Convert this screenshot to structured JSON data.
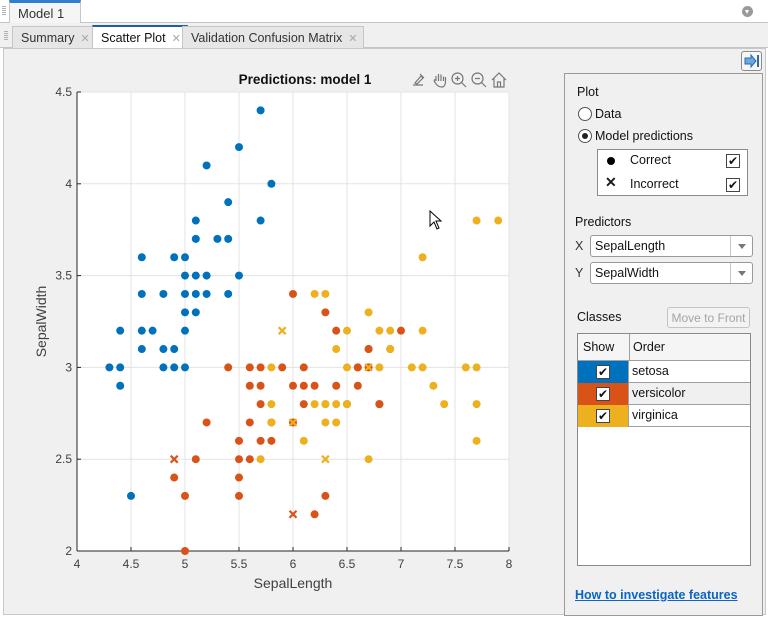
{
  "document_tabs": [
    {
      "label": "Model 1",
      "active": true
    }
  ],
  "tabs": [
    {
      "label": "Summary",
      "active": false
    },
    {
      "label": "Scatter Plot",
      "active": true
    },
    {
      "label": "Validation Confusion Matrix",
      "active": false
    }
  ],
  "axes_toolbar": [
    "brush-icon",
    "pan-icon",
    "zoom-in-icon",
    "zoom-out-icon",
    "home-icon"
  ],
  "panel": {
    "plot_heading": "Plot",
    "radio_data": "Data",
    "radio_predictions": "Model predictions",
    "selected_radio": "Model predictions",
    "legend_correct": "Correct",
    "legend_incorrect": "Incorrect",
    "show_correct": true,
    "show_incorrect": true,
    "predictors_heading": "Predictors",
    "x_label": "X",
    "y_label": "Y",
    "x_value": "SepalLength",
    "y_value": "SepalWidth",
    "classes_heading": "Classes",
    "move_to_front": "Move to Front",
    "col_show": "Show",
    "col_order": "Order",
    "classes": [
      {
        "name": "setosa",
        "color": "#0072BD",
        "shown": true
      },
      {
        "name": "versicolor",
        "color": "#D95319",
        "shown": true
      },
      {
        "name": "virginica",
        "color": "#EDB120",
        "shown": true
      }
    ],
    "help_link": "How to investigate features"
  },
  "chart_data": {
    "type": "scatter",
    "title": "Predictions: model 1",
    "xlabel": "SepalLength",
    "ylabel": "SepalWidth",
    "xlim": [
      4,
      8
    ],
    "ylim": [
      2,
      4.5
    ],
    "xticks": [
      "4",
      "4.5",
      "5",
      "5.5",
      "6",
      "6.5",
      "7",
      "7.5",
      "8"
    ],
    "yticks": [
      "2",
      "2.5",
      "3",
      "3.5",
      "4",
      "4.5"
    ],
    "grid": true,
    "legend": "none",
    "colors": {
      "setosa": "#0072BD",
      "versicolor": "#D95319",
      "virginica": "#EDB120"
    },
    "series": [
      {
        "name": "setosa",
        "marker": "correct",
        "points": [
          [
            5.7,
            4.4
          ],
          [
            5.5,
            4.2
          ],
          [
            5.2,
            4.1
          ],
          [
            5.8,
            4.0
          ],
          [
            5.4,
            3.9
          ],
          [
            5.1,
            3.8
          ],
          [
            5.7,
            3.8
          ],
          [
            5.1,
            3.7
          ],
          [
            5.3,
            3.7
          ],
          [
            5.4,
            3.7
          ],
          [
            4.6,
            3.6
          ],
          [
            4.9,
            3.6
          ],
          [
            5.0,
            3.6
          ],
          [
            5.0,
            3.5
          ],
          [
            5.1,
            3.5
          ],
          [
            5.2,
            3.5
          ],
          [
            5.5,
            3.5
          ],
          [
            4.6,
            3.4
          ],
          [
            4.8,
            3.4
          ],
          [
            5.0,
            3.4
          ],
          [
            5.1,
            3.4
          ],
          [
            5.2,
            3.4
          ],
          [
            5.4,
            3.4
          ],
          [
            5.0,
            3.3
          ],
          [
            5.1,
            3.3
          ],
          [
            4.4,
            3.2
          ],
          [
            4.6,
            3.2
          ],
          [
            4.7,
            3.2
          ],
          [
            5.0,
            3.2
          ],
          [
            4.6,
            3.1
          ],
          [
            4.8,
            3.1
          ],
          [
            4.9,
            3.1
          ],
          [
            4.3,
            3.0
          ],
          [
            4.4,
            3.0
          ],
          [
            4.8,
            3.0
          ],
          [
            4.9,
            3.0
          ],
          [
            5.0,
            3.0
          ],
          [
            4.4,
            2.9
          ],
          [
            4.5,
            2.3
          ]
        ]
      },
      {
        "name": "versicolor",
        "marker": "correct",
        "points": [
          [
            6.0,
            3.4
          ],
          [
            6.3,
            3.3
          ],
          [
            6.7,
            3.1
          ],
          [
            6.9,
            3.1
          ],
          [
            7.0,
            3.2
          ],
          [
            6.4,
            3.2
          ],
          [
            6.6,
            3.0
          ],
          [
            6.8,
            2.8
          ],
          [
            6.7,
            3.1
          ],
          [
            5.4,
            3.0
          ],
          [
            5.6,
            3.0
          ],
          [
            5.7,
            3.0
          ],
          [
            5.9,
            3.0
          ],
          [
            6.1,
            3.0
          ],
          [
            6.6,
            3.0
          ],
          [
            6.7,
            3.0
          ],
          [
            5.6,
            2.9
          ],
          [
            5.7,
            2.9
          ],
          [
            6.0,
            2.9
          ],
          [
            6.1,
            2.9
          ],
          [
            6.2,
            2.9
          ],
          [
            6.4,
            2.9
          ],
          [
            6.6,
            2.9
          ],
          [
            5.7,
            2.8
          ],
          [
            6.1,
            2.8
          ],
          [
            6.5,
            2.8
          ],
          [
            6.8,
            2.8
          ],
          [
            5.2,
            2.7
          ],
          [
            5.6,
            2.7
          ],
          [
            5.8,
            2.7
          ],
          [
            6.0,
            2.7
          ],
          [
            5.5,
            2.6
          ],
          [
            5.7,
            2.6
          ],
          [
            5.8,
            2.6
          ],
          [
            5.5,
            2.5
          ],
          [
            5.1,
            2.5
          ],
          [
            5.6,
            2.5
          ],
          [
            4.9,
            2.4
          ],
          [
            5.5,
            2.4
          ],
          [
            5.0,
            2.3
          ],
          [
            5.5,
            2.3
          ],
          [
            6.3,
            2.3
          ],
          [
            6.2,
            2.2
          ],
          [
            5.0,
            2.0
          ]
        ]
      },
      {
        "name": "virginica",
        "marker": "correct",
        "points": [
          [
            7.7,
            3.8
          ],
          [
            7.9,
            3.8
          ],
          [
            7.2,
            3.6
          ],
          [
            6.2,
            3.4
          ],
          [
            6.3,
            3.4
          ],
          [
            6.7,
            3.3
          ],
          [
            7.2,
            3.2
          ],
          [
            6.5,
            3.2
          ],
          [
            6.8,
            3.2
          ],
          [
            6.9,
            3.2
          ],
          [
            6.4,
            3.1
          ],
          [
            6.9,
            3.1
          ],
          [
            5.8,
            2.8
          ],
          [
            6.3,
            2.8
          ],
          [
            5.8,
            3.0
          ],
          [
            6.5,
            3.0
          ],
          [
            6.8,
            3.0
          ],
          [
            7.1,
            3.0
          ],
          [
            7.2,
            3.0
          ],
          [
            7.6,
            3.0
          ],
          [
            7.7,
            3.0
          ],
          [
            6.4,
            2.8
          ],
          [
            6.5,
            2.8
          ],
          [
            6.3,
            2.8
          ],
          [
            7.4,
            2.8
          ],
          [
            7.7,
            2.8
          ],
          [
            6.2,
            2.8
          ],
          [
            7.3,
            2.9
          ],
          [
            5.7,
            2.5
          ],
          [
            6.1,
            2.6
          ],
          [
            6.4,
            2.7
          ],
          [
            6.3,
            2.7
          ],
          [
            7.7,
            2.6
          ],
          [
            6.7,
            2.5
          ],
          [
            5.8,
            2.7
          ]
        ]
      },
      {
        "name": "versicolor",
        "marker": "incorrect",
        "points": [
          [
            4.9,
            2.5
          ],
          [
            6.0,
            2.2
          ]
        ]
      },
      {
        "name": "virginica",
        "marker": "incorrect",
        "points": [
          [
            5.9,
            3.2
          ],
          [
            6.0,
            2.7
          ],
          [
            6.3,
            2.5
          ],
          [
            6.7,
            3.0
          ]
        ]
      }
    ]
  }
}
